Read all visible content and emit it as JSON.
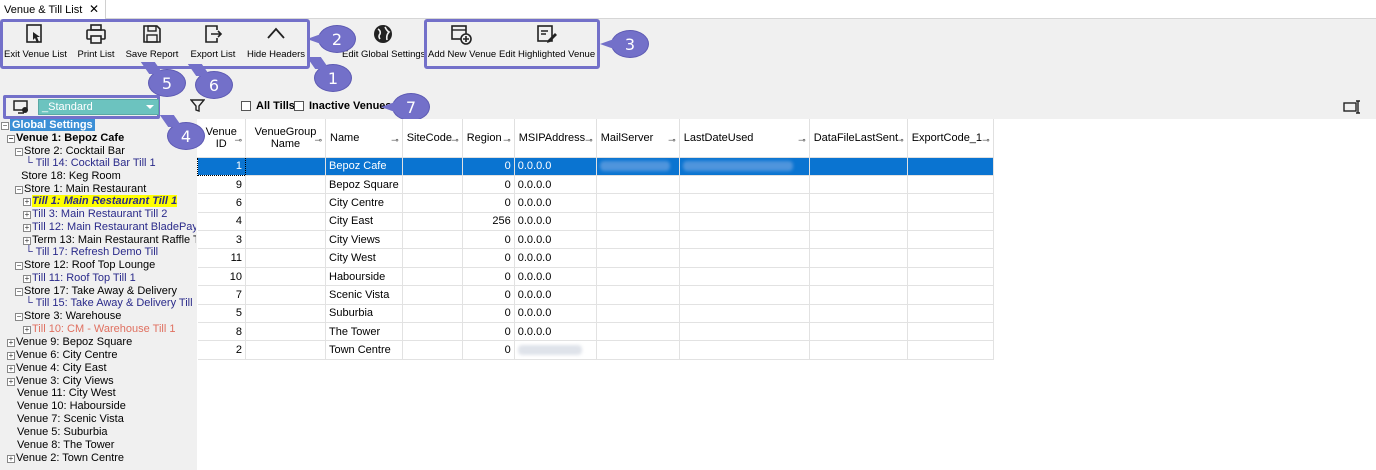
{
  "tab": {
    "title": "Venue & Till List",
    "close": "✕"
  },
  "ribbon": {
    "buttons": {
      "exit": "Exit Venue List",
      "print": "Print List",
      "save": "Save Report",
      "export": "Export List",
      "hide": "Hide Headers",
      "global": "Edit Global Settings",
      "add": "Add New Venue",
      "edit": "Edit Highlighted Venue"
    },
    "badges": {
      "b1": "1",
      "b2": "2",
      "b3": "3",
      "b4": "4",
      "b5": "5",
      "b6": "6",
      "b7": "7"
    },
    "accent": "#7370c9"
  },
  "filter": {
    "layout_value": "_Standard",
    "all_tills": "All Tills",
    "inactive_venues": "Inactive Venues"
  },
  "tree": {
    "nodes": [
      "Global Settings",
      "Venue 1: Bepoz Cafe",
      "Store 2: Cocktail Bar",
      "Till 14: Cocktail Bar Till 1",
      "Store 18: Keg Room",
      "Store 1: Main Restaurant",
      "Till 1: Main Restaurant Till 1",
      "Till 3: Main Restaurant Till 2",
      "Till 12: Main Restaurant BladePay",
      "Term 13: Main Restaurant Raffle T",
      "Till 17: Refresh Demo Till",
      "Store 12: Roof Top Lounge",
      "Till 11: Roof Top Till 1",
      "Store 17: Take Away & Delivery",
      "Till 15: Take Away & Delivery Till 1",
      "Store 3: Warehouse",
      "Till 10: CM - Warehouse Till 1",
      "Venue 9: Bepoz Square",
      "Venue 6: City Centre",
      "Venue 4: City East",
      "Venue 3: City Views",
      "Venue 11: City West",
      "Venue 10: Habourside",
      "Venue 7: Scenic Vista",
      "Venue 5: Suburbia",
      "Venue 8: The Tower",
      "Venue 2: Town Centre"
    ]
  },
  "grid": {
    "headers": [
      "Venue ID",
      "VenueGroup Name",
      "Name",
      "SiteCode",
      "Region",
      "MSIPAddress",
      "MailServer",
      "LastDateUsed",
      "DataFileLastSent",
      "ExportCode_1"
    ],
    "rows": [
      {
        "id": "1",
        "name": "Bepoz Cafe",
        "region": "0",
        "ip": "0.0.0.0"
      },
      {
        "id": "9",
        "name": "Bepoz Square",
        "region": "0",
        "ip": "0.0.0.0"
      },
      {
        "id": "6",
        "name": "City Centre",
        "region": "0",
        "ip": "0.0.0.0"
      },
      {
        "id": "4",
        "name": "City East",
        "region": "256",
        "ip": "0.0.0.0"
      },
      {
        "id": "3",
        "name": "City Views",
        "region": "0",
        "ip": "0.0.0.0"
      },
      {
        "id": "11",
        "name": "City West",
        "region": "0",
        "ip": "0.0.0.0"
      },
      {
        "id": "10",
        "name": "Habourside",
        "region": "0",
        "ip": "0.0.0.0"
      },
      {
        "id": "7",
        "name": "Scenic Vista",
        "region": "0",
        "ip": "0.0.0.0"
      },
      {
        "id": "5",
        "name": "Suburbia",
        "region": "0",
        "ip": "0.0.0.0"
      },
      {
        "id": "8",
        "name": "The Tower",
        "region": "0",
        "ip": "0.0.0.0"
      },
      {
        "id": "2",
        "name": "Town Centre",
        "region": "0",
        "ip": ""
      }
    ],
    "selected_color": "#0a74d1"
  }
}
